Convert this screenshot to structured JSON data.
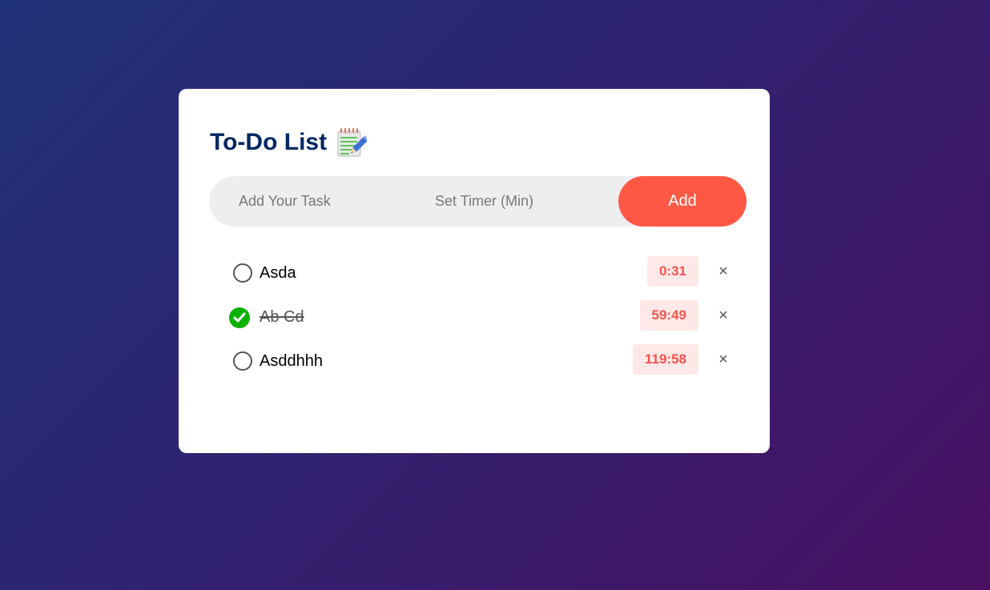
{
  "app": {
    "title": "To-Do List",
    "title_icon": "notepad-pencil-icon"
  },
  "inputs": {
    "task_placeholder": "Add Your Task",
    "task_value": "",
    "timer_placeholder": "Set Timer (Min)",
    "timer_value": "",
    "add_label": "Add"
  },
  "tasks": [
    {
      "label": "Asda",
      "timer": "0:31",
      "completed": false
    },
    {
      "label": "Ab Cd",
      "timer": "59:49",
      "completed": true
    },
    {
      "label": "Asddhhh",
      "timer": "119:58",
      "completed": false
    }
  ],
  "delete_glyph": "×",
  "colors": {
    "accent": "#ff5945",
    "title": "#002765",
    "check_done": "#0bb000",
    "timer_text": "#f2544a",
    "timer_bg": "#ffe8e8"
  }
}
